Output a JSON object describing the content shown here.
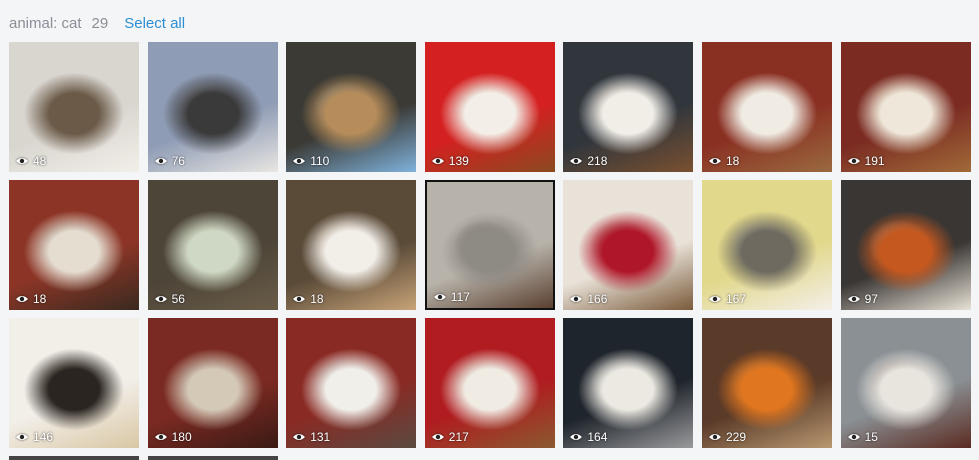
{
  "header": {
    "filter": "animal: cat",
    "count": "29",
    "select_all": "Select all"
  },
  "icons": {
    "views": "eye-icon"
  },
  "tiles": [
    {
      "views": "48",
      "c1": "#d9d6d0",
      "c2": "#6b5a48",
      "c3": "#f2efe9"
    },
    {
      "views": "76",
      "c1": "#8f9cb5",
      "c2": "#3a3a3a",
      "c3": "#e8e6e2"
    },
    {
      "views": "110",
      "c1": "#3b3a35",
      "c2": "#b58c5a",
      "c3": "#7fb2dc"
    },
    {
      "views": "139",
      "c1": "#d42020",
      "c2": "#f3efe8",
      "c3": "#8a4a20"
    },
    {
      "views": "218",
      "c1": "#30363c",
      "c2": "#f1eee8",
      "c3": "#7a5030"
    },
    {
      "views": "18",
      "c1": "#8a3022",
      "c2": "#f0ece4",
      "c3": "#9a6a40"
    },
    {
      "views": "191",
      "c1": "#7b2b22",
      "c2": "#efe8da",
      "c3": "#a06a38"
    },
    {
      "views": "18",
      "c1": "#8c3526",
      "c2": "#e4ddd0",
      "c3": "#3a2a20"
    },
    {
      "views": "56",
      "c1": "#4d4538",
      "c2": "#cfd8c4",
      "c3": "#6a5c48"
    },
    {
      "views": "18",
      "c1": "#5a4a38",
      "c2": "#f2eee8",
      "c3": "#c8a478"
    },
    {
      "views": "117",
      "c1": "#b8b3aa",
      "c2": "#8e8a84",
      "c3": "#5a4030",
      "selected": true
    },
    {
      "views": "166",
      "c1": "#e9e2d8",
      "c2": "#b0162a",
      "c3": "#7a5a3a"
    },
    {
      "views": "167",
      "c1": "#e2d88c",
      "c2": "#6e6a60",
      "c3": "#f3efe8"
    },
    {
      "views": "97",
      "c1": "#3a3634",
      "c2": "#c5581f",
      "c3": "#e8e2d6"
    },
    {
      "views": "146",
      "c1": "#f2eee8",
      "c2": "#2a2520",
      "c3": "#d9c7a4"
    },
    {
      "views": "180",
      "c1": "#7a2a22",
      "c2": "#d4c8b6",
      "c3": "#3a1a14"
    },
    {
      "views": "131",
      "c1": "#8a2a24",
      "c2": "#f1efea",
      "c3": "#5a4a40"
    },
    {
      "views": "217",
      "c1": "#b01c20",
      "c2": "#f0ece4",
      "c3": "#8a5a30"
    },
    {
      "views": "164",
      "c1": "#1f252c",
      "c2": "#ece9e2",
      "c3": "#9a9a9c"
    },
    {
      "views": "229",
      "c1": "#5a3a28",
      "c2": "#e0761f",
      "c3": "#b89870"
    },
    {
      "views": "15",
      "c1": "#8a9094",
      "c2": "#e8e4de",
      "c3": "#5a2a20"
    }
  ]
}
